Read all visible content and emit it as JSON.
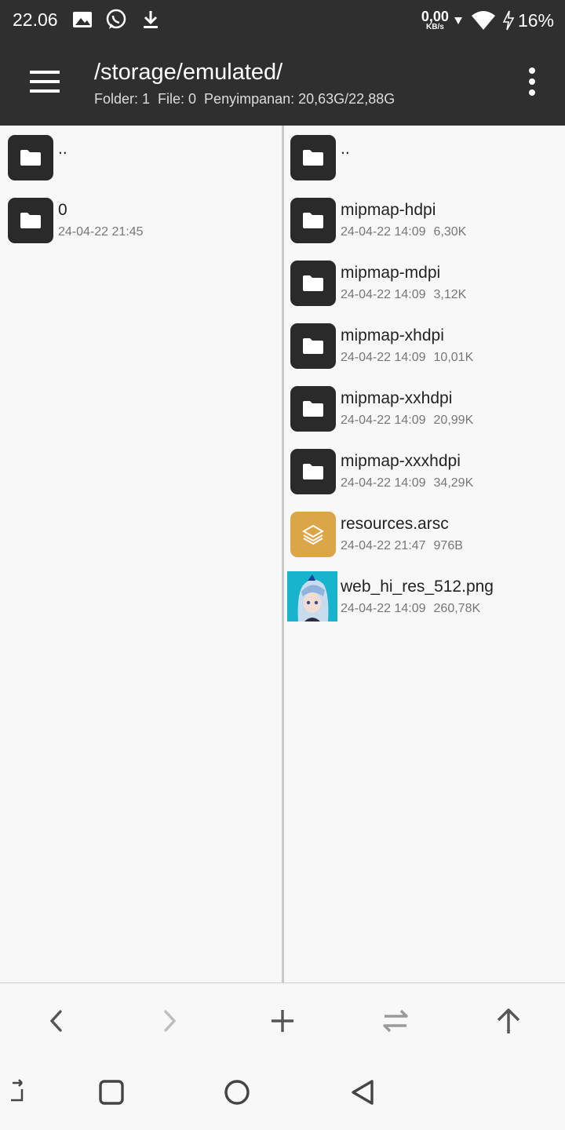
{
  "status_bar": {
    "time": "22.06",
    "net_speed_value": "0,00",
    "net_speed_unit": "KB/s",
    "battery": "16%"
  },
  "app_bar": {
    "path": "/storage/emulated/",
    "info": "Folder: 1  File: 0  Penyimpanan: 20,63G/22,88G"
  },
  "left_pane": {
    "items": [
      {
        "name": "..",
        "date": "",
        "size": "",
        "icon": "folder-icon"
      },
      {
        "name": "0",
        "date": "24-04-22 21:45",
        "size": "",
        "icon": "folder-icon"
      }
    ]
  },
  "right_pane": {
    "items": [
      {
        "name": "..",
        "date": "",
        "size": "",
        "icon": "folder-icon"
      },
      {
        "name": "mipmap-hdpi",
        "date": "24-04-22 14:09",
        "size": "6,30K",
        "icon": "folder-icon"
      },
      {
        "name": "mipmap-mdpi",
        "date": "24-04-22 14:09",
        "size": "3,12K",
        "icon": "folder-icon"
      },
      {
        "name": "mipmap-xhdpi",
        "date": "24-04-22 14:09",
        "size": "10,01K",
        "icon": "folder-icon"
      },
      {
        "name": "mipmap-xxhdpi",
        "date": "24-04-22 14:09",
        "size": "20,99K",
        "icon": "folder-icon"
      },
      {
        "name": "mipmap-xxxhdpi",
        "date": "24-04-22 14:09",
        "size": "34,29K",
        "icon": "folder-icon"
      },
      {
        "name": "resources.arsc",
        "date": "24-04-22 21:47",
        "size": "976B",
        "icon": "layers-icon"
      },
      {
        "name": "web_hi_res_512.png",
        "date": "24-04-22 14:09",
        "size": "260,78K",
        "icon": "image-thumbnail"
      }
    ]
  },
  "colors": {
    "app_bar": "#2f2f2f",
    "folder_icon_bg": "#2a2a2a",
    "arsc_icon_bg": "#dca548",
    "thumbnail_bg": "#17b4cc"
  }
}
